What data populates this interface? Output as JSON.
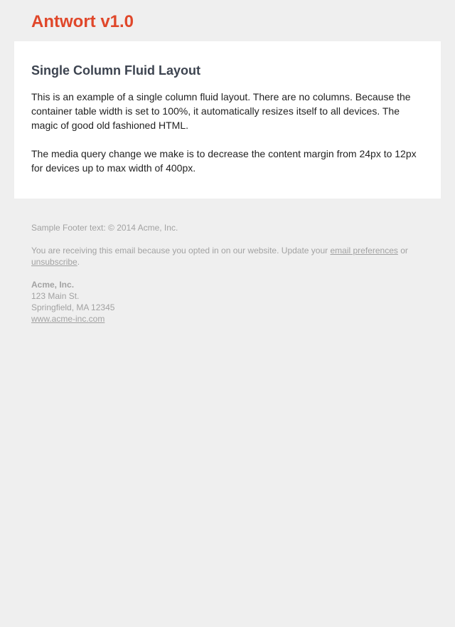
{
  "header": {
    "logo_text": "Antwort v1.0"
  },
  "content": {
    "title": "Single Column Fluid Layout",
    "paragraph_1": "This is an example of a single column fluid layout. There are no columns. Because the container table width is set to 100%, it automatically resizes itself to all devices. The magic of good old fashioned HTML.",
    "paragraph_2": "The media query change we make is to decrease the content margin from 24px to 12px for devices up to max width of 400px."
  },
  "footer": {
    "sample_text": "Sample Footer text: © 2014 Acme, Inc.",
    "receiving_text_before": "You are receiving this email because you opted in on our website. Update your ",
    "email_preferences_link": "email preferences",
    "receiving_text_or": " or ",
    "unsubscribe_link": "unsubscribe",
    "period": ".",
    "address": {
      "company": "Acme, Inc.",
      "street": "123 Main St.",
      "city": "Springfield, MA 12345",
      "website": "www.acme-inc.com"
    }
  },
  "colors": {
    "brand": "#e0472a",
    "heading": "#3d4450",
    "footer_text": "#a2a2a2",
    "background": "#efefef"
  }
}
